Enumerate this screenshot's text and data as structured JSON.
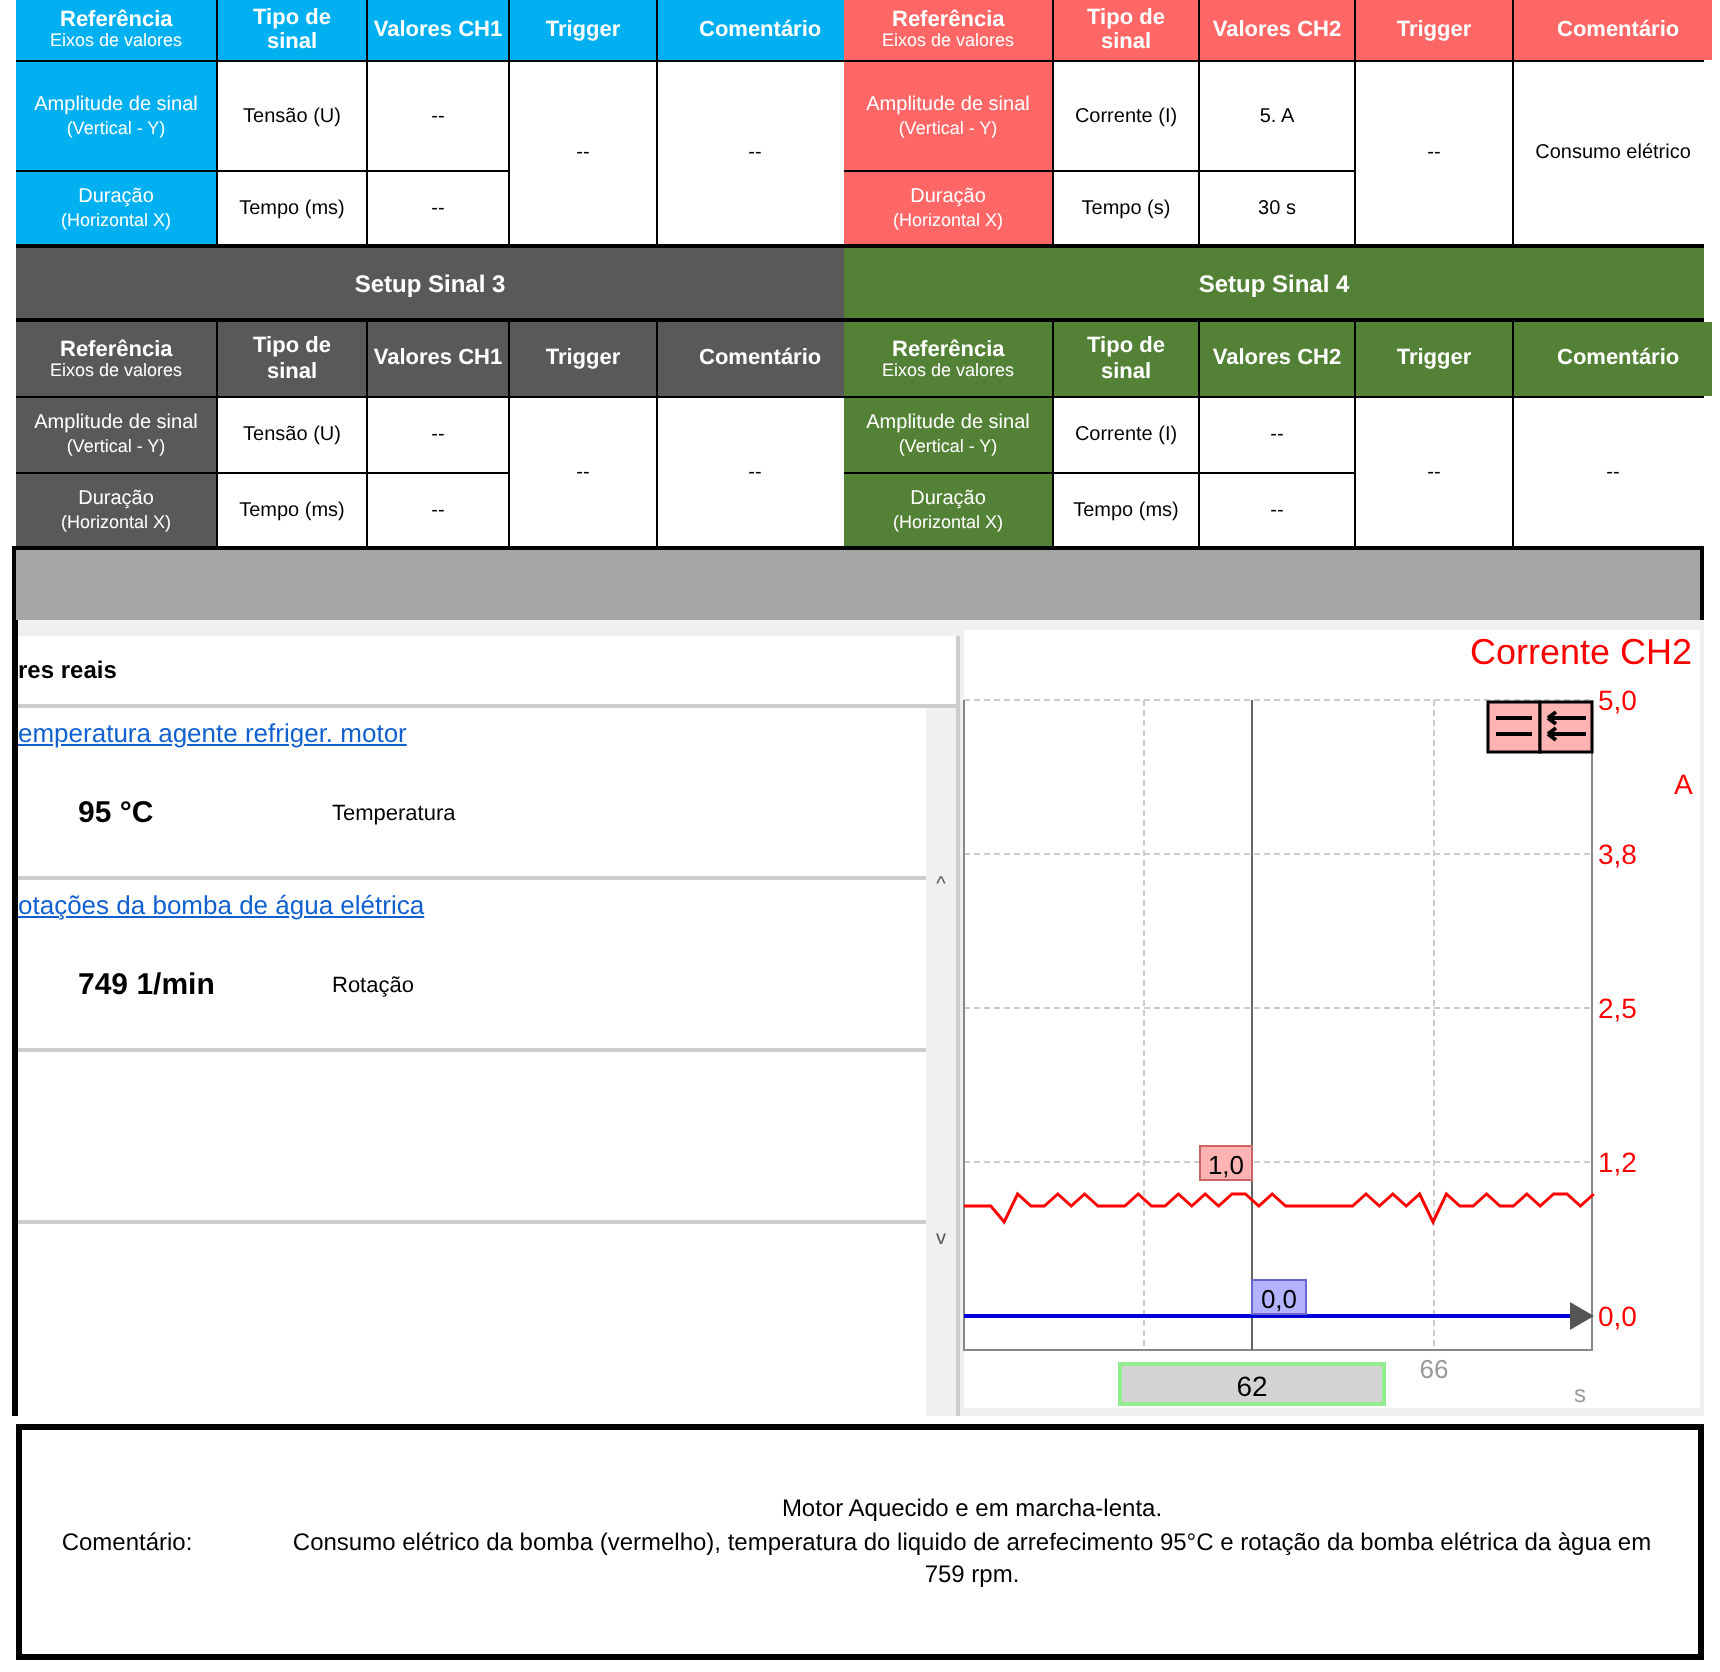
{
  "setups": [
    {
      "color": "#00b0f0",
      "headers": [
        {
          "title": "Referência",
          "sub": "Eixos de valores"
        },
        {
          "title": "Tipo de sinal"
        },
        {
          "title": "Valores CH1"
        },
        {
          "title": "Trigger"
        },
        {
          "title": "Comentário"
        }
      ],
      "rows": [
        {
          "reference": "Amplitude de sinal",
          "axis": "(Vertical - Y)",
          "signal_type": "Tensão (U)",
          "value": "--"
        },
        {
          "reference": "Duração",
          "axis": "(Horizontal X)",
          "signal_type": "Tempo (ms)",
          "value": "--"
        }
      ],
      "trigger": "--",
      "comment": "--"
    },
    {
      "color": "#ff6666",
      "headers": [
        {
          "title": "Referência",
          "sub": "Eixos de valores"
        },
        {
          "title": "Tipo de sinal"
        },
        {
          "title": "Valores CH2"
        },
        {
          "title": "Trigger"
        },
        {
          "title": "Comentário"
        }
      ],
      "rows": [
        {
          "reference": "Amplitude de sinal",
          "axis": "(Vertical - Y)",
          "signal_type": "Corrente (I)",
          "value": "5. A"
        },
        {
          "reference": "Duração",
          "axis": "(Horizontal X)",
          "signal_type": "Tempo (s)",
          "value": "30 s"
        }
      ],
      "trigger": "--",
      "comment": "Consumo elétrico"
    },
    {
      "title": "Setup Sinal 3",
      "color": "#595959",
      "headers": [
        {
          "title": "Referência",
          "sub": "Eixos de valores"
        },
        {
          "title": "Tipo de sinal"
        },
        {
          "title": "Valores CH1"
        },
        {
          "title": "Trigger"
        },
        {
          "title": "Comentário"
        }
      ],
      "rows": [
        {
          "reference": "Amplitude de sinal",
          "axis": "(Vertical - Y)",
          "signal_type": "Tensão (U)",
          "value": "--"
        },
        {
          "reference": "Duração",
          "axis": "(Horizontal X)",
          "signal_type": "Tempo (ms)",
          "value": "--"
        }
      ],
      "trigger": "--",
      "comment": "--"
    },
    {
      "title": "Setup Sinal 4",
      "color": "#538135",
      "headers": [
        {
          "title": "Referência",
          "sub": "Eixos de valores"
        },
        {
          "title": "Tipo de sinal"
        },
        {
          "title": "Valores CH2"
        },
        {
          "title": "Trigger"
        },
        {
          "title": "Comentário"
        }
      ],
      "rows": [
        {
          "reference": "Amplitude de sinal",
          "axis": "(Vertical - Y)",
          "signal_type": "Corrente (I)",
          "value": "--"
        },
        {
          "reference": "Duração",
          "axis": "(Horizontal X)",
          "signal_type": "Tempo (ms)",
          "value": "--"
        }
      ],
      "trigger": "--",
      "comment": "--"
    }
  ],
  "actual_values": {
    "title": "res reais",
    "items": [
      {
        "name": "emperatura agente refriger. motor",
        "value": "95 °C",
        "label": "Temperatura"
      },
      {
        "name": "otações da bomba de água elétrica",
        "value": "749 1/min",
        "label": "Rotação"
      }
    ],
    "scroll_up": "^",
    "scroll_down": "v"
  },
  "scope": {
    "title": "Corrente CH2",
    "unit": "A",
    "y_labels": [
      "5,0",
      "3,8",
      "2,5",
      "1,2",
      "0,0"
    ],
    "x_label": "66",
    "x_unit": "s",
    "cursor_time": "62",
    "trace_marker": "1,0",
    "baseline_marker": "0,0"
  },
  "comment": {
    "label": "Comentário:",
    "heading": "Motor Aquecido e em marcha-lenta.",
    "text": "Consumo elétrico da bomba (vermelho), temperatura do liquido de arrefecimento 95°C e rotação da bomba elétrica da àgua em 759 rpm."
  }
}
